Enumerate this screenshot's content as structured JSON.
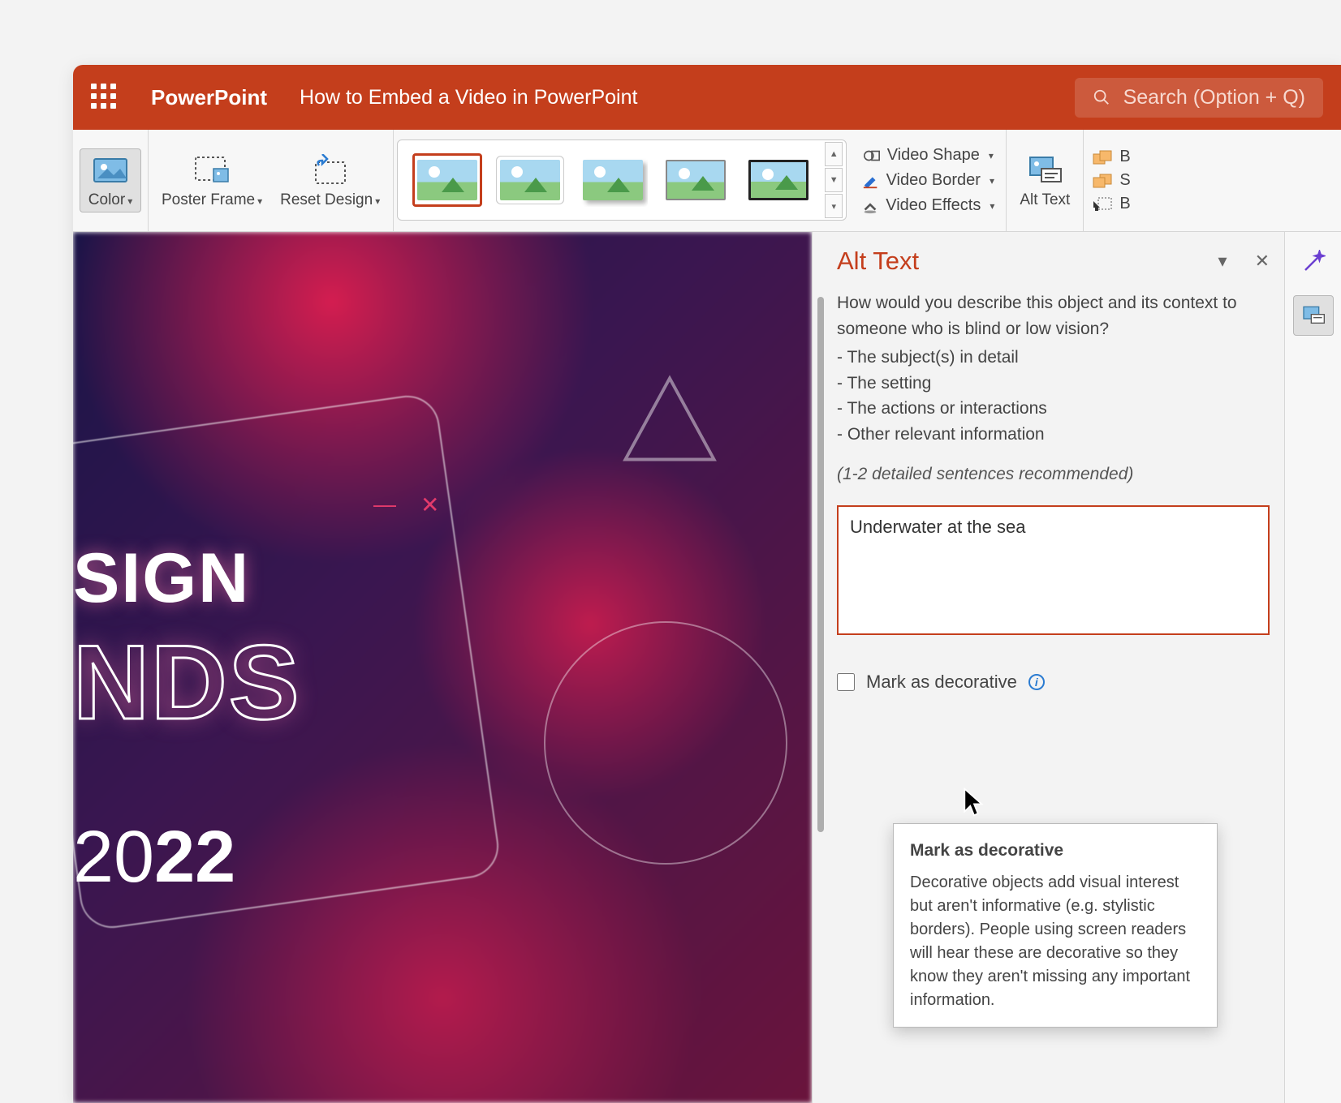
{
  "titlebar": {
    "app_name": "PowerPoint",
    "doc_title": "How to Embed a Video in PowerPoint",
    "search_placeholder": "Search (Option + Q)"
  },
  "ribbon": {
    "color_label": "Color",
    "poster_label": "Poster Frame",
    "reset_label": "Reset Design",
    "video_shape": "Video Shape",
    "video_border": "Video Border",
    "video_effects": "Video Effects",
    "alt_text": "Alt Text",
    "bring_forward_short": "B",
    "send_backward_short": "S",
    "selection_short": "B"
  },
  "slide": {
    "line1": "SIGN",
    "line2": "NDS",
    "year_prefix": "20",
    "year_bold": "22"
  },
  "alt_panel": {
    "title": "Alt Text",
    "question": "How would you describe this object and its context to someone who is blind or low vision?",
    "bullets": [
      "The subject(s) in detail",
      "The setting",
      "The actions or interactions",
      "Other relevant information"
    ],
    "hint": "(1-2 detailed sentences recommended)",
    "textarea_value": "Underwater at the sea",
    "decorative_label": "Mark as decorative"
  },
  "tooltip": {
    "title": "Mark as decorative",
    "body": "Decorative objects add visual interest but aren't informative (e.g. stylistic borders). People using screen readers will hear these are decorative so they know they aren't missing any important information."
  }
}
